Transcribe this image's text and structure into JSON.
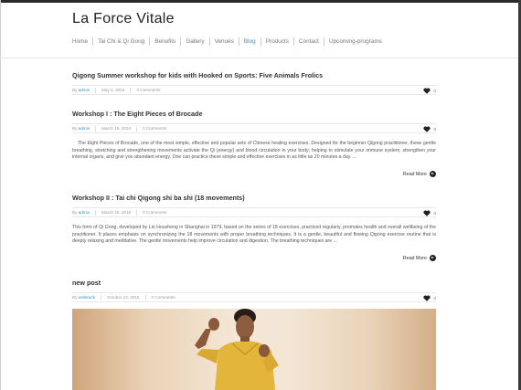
{
  "site": {
    "title": "La Force Vitale"
  },
  "nav": {
    "items": [
      {
        "label": "Home"
      },
      {
        "label": "Tai Chi & Qi Gong"
      },
      {
        "label": "Benefits"
      },
      {
        "label": "Gallery"
      },
      {
        "label": "Venues"
      },
      {
        "label": "Blog"
      },
      {
        "label": "Products"
      },
      {
        "label": "Contact"
      },
      {
        "label": "Upcoming-programs"
      }
    ],
    "active": "Blog"
  },
  "posts": [
    {
      "title": "Qigong Summer workshop for kids with Hooked on Sports: Five Animals Frolics",
      "by": "By",
      "author": "admin",
      "date": "May 6, 2016",
      "comments": "0 Comments",
      "likes": "0"
    },
    {
      "title": "Workshop I : The Eight Pieces of Brocade",
      "by": "By",
      "author": "admin",
      "date": "March 15, 2016",
      "comments": "0 Comments",
      "likes": "0",
      "excerpt": "The Eight Pieces of Brocade, one of the most simple, effective and popular sets of Chinese healing exercises. Designed for the beginner Qigong practitioner, these gentle breathing, stretching and strengthening movements activate the Qi (energy) and blood circulation in your body; helping to stimulate your immune system, strengthen your internal organs, and give you abundant energy. One can practice these simple and effective exercises in as little as 20 minutes a day. ...",
      "read_more": "Read More"
    },
    {
      "title": "Workshop II : Tai chi Qigong shi ba shi (18 movements)",
      "by": "By",
      "author": "admin",
      "date": "March 15, 2016",
      "comments": "0 Comments",
      "likes": "0",
      "excerpt": "This form of Qi Gong, developed by Lin Housheng in Shanghai in 1979, based on the series of 18 exercises, practiced regularly, promotes health and overall wellbeing of the practitioner. It places emphasis on synchronizing the 18 movements with proper breathing techniques. It is a gentle, beautiful and flowing Qigong exercise routine that is deeply relaxing and meditative. The gentle movements help improve circulation and digestion. The breathing techniques are ...",
      "read_more": "Read More"
    },
    {
      "title": "new post",
      "by": "By",
      "author": "webtrack",
      "date": "October 22, 2015",
      "comments": "0 Comments",
      "likes": "0"
    }
  ],
  "colors": {
    "accent": "#3a8fbf",
    "text": "#333333",
    "muted": "#999999"
  },
  "icons": {
    "like": "heart-icon",
    "read_more": "arrow-circle-right-icon"
  }
}
